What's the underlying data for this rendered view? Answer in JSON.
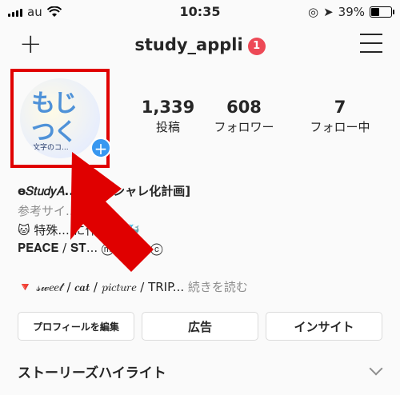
{
  "status_bar": {
    "carrier": "au",
    "time": "10:35",
    "battery": "39%"
  },
  "header": {
    "plus_label": "+",
    "username": "study_appli",
    "notification_count": "1"
  },
  "profile": {
    "avatar_text_1": "もじ",
    "avatar_text_2": "つく",
    "avatar_caption": "文字のコ...",
    "add_story_label": "+",
    "stats": [
      {
        "value": "1,339",
        "label": "投稿"
      },
      {
        "value": "608",
        "label": "フォロワー"
      },
      {
        "value": "7",
        "label": "フォロー中"
      }
    ],
    "bio": {
      "line1": "ѳ𝑆𝑡𝑢𝑑𝑦𝐴... NSオシャレ化計画]",
      "line2": "参考サイ...",
      "line3": "🐱 特殊... に作れる 🐳",
      "line4": "𝐏𝐄𝐀𝐂𝐄 / 𝐒𝐓... ⓜⓤⓢⓘⓒ",
      "line5": "🔻 𝓈𝓌𝑒𝑒𝓉 / 𝒄𝒂𝒕 / 𝑝𝑖𝑐𝑡𝑢𝑟𝑒 / TRIP...",
      "more": "続きを読む"
    }
  },
  "buttons": {
    "edit_profile": "プロフィールを編集",
    "promotions": "広告",
    "insights": "インサイト"
  },
  "highlights": {
    "title": "ストーリーズハイライト"
  },
  "colors": {
    "highlight_box": "#e00000",
    "arrow": "#e00000",
    "badge": "#ed4956"
  }
}
